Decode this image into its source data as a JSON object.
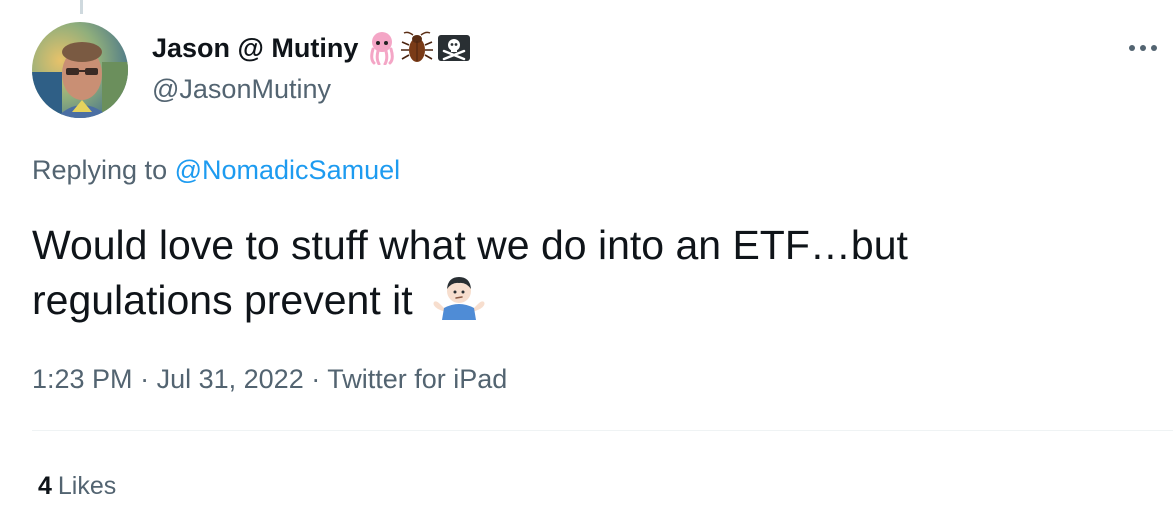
{
  "author": {
    "display_name": "Jason @ Mutiny",
    "name_emojis": [
      "squid-icon",
      "cockroach-icon",
      "pirate-flag-icon"
    ],
    "handle": "@JasonMutiny"
  },
  "reply": {
    "prefix": "Replying to",
    "mention": "@NomadicSamuel"
  },
  "tweet": {
    "text": "Would love to stuff what we do into an ETF…but regulations prevent it",
    "trailing_emoji": "person-shrugging-icon"
  },
  "meta": {
    "time": "1:23 PM",
    "separator": "·",
    "date": "Jul 31, 2022",
    "source": "Twitter for iPad"
  },
  "stats": {
    "likes_count": "4",
    "likes_label": "Likes"
  },
  "colors": {
    "link": "#1d9bf0",
    "secondary_text": "#536471",
    "primary_text": "#0f1419",
    "divider": "#eff3f4"
  }
}
